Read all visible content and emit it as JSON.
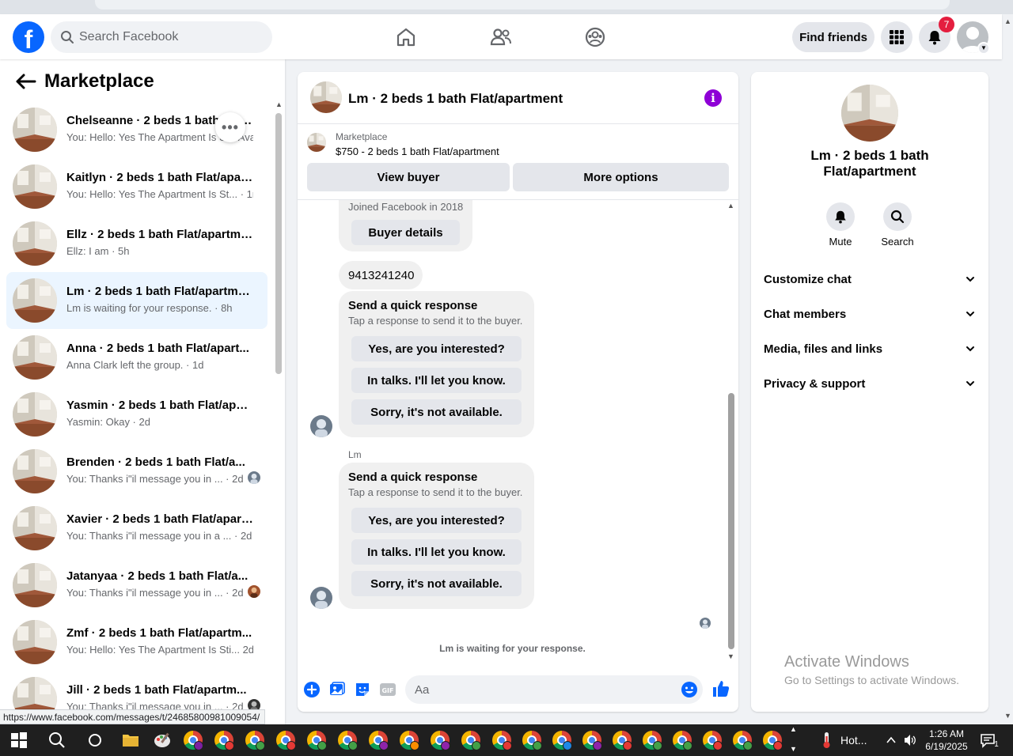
{
  "topnav": {
    "logo_letter": "f",
    "search_placeholder": "Search Facebook",
    "find_friends_label": "Find friends",
    "notification_count": "7"
  },
  "sidebar": {
    "title": "Marketplace",
    "more_label": "•••",
    "chats": [
      {
        "name": "Chelseanne · 2 beds 1 bath Flat/apartment",
        "preview": "You: Hello: Yes The Apartment Is Still Available · 1m"
      },
      {
        "name": "Kaitlyn · 2 beds 1 bath Flat/apart...",
        "preview": "You: Hello: Yes The Apartment Is St... · 1m"
      },
      {
        "name": "Ellz · 2 beds 1 bath Flat/apartment",
        "preview": "Ellz: I am · 5h"
      },
      {
        "name": "Lm · 2 beds 1 bath Flat/apartment",
        "preview": "Lm is waiting for your response. · 8h"
      },
      {
        "name": "Anna · 2 beds 1 bath Flat/apart...",
        "preview": "Anna Clark left the group. · 1d"
      },
      {
        "name": "Yasmin · 2 beds 1 bath Flat/apart...",
        "preview": "Yasmin: Okay · 2d"
      },
      {
        "name": "Brenden · 2 beds 1 bath Flat/a...",
        "preview": "You: Thanks i\"il message you in ... · 2d"
      },
      {
        "name": "Xavier · 2 beds 1 bath Flat/apart...",
        "preview": "You: Thanks i\"il message you in a ...   · 2d"
      },
      {
        "name": "Jatanyaa · 2 beds 1 bath Flat/a...",
        "preview": "You: Thanks i\"il message you in ... · 2d"
      },
      {
        "name": "Zmf · 2 beds 1 bath Flat/apartm...",
        "preview": "You: Hello: Yes The Apartment Is Sti... 2d"
      },
      {
        "name": "Jill · 2 beds 1 bath Flat/apartm...",
        "preview": "You: Thanks i\"il message you in ... · 2d"
      }
    ]
  },
  "status_url": "https://www.facebook.com/messages/t/24685800981009054/",
  "chat": {
    "title": "Lm · 2 beds 1 bath Flat/apartment",
    "listing_label": "Marketplace",
    "listing_desc": "$750 - 2 beds 1 bath Flat/apartment",
    "view_buyer_label": "View buyer",
    "more_options_label": "More options",
    "joined_text": "Joined Facebook in 2018",
    "buyer_details_label": "Buyer details",
    "phone_message": "9413241240",
    "sender_name": "Lm",
    "quick_response": {
      "title": "Send a quick response",
      "subtitle": "Tap a response to send it to the buyer.",
      "options": [
        "Yes, are you interested?",
        "In talks. I'll let you know.",
        "Sorry, it's not available."
      ]
    },
    "waiting_text": "Lm is waiting for your response.",
    "composer_placeholder": "Aa"
  },
  "info": {
    "name": "Lm · 2 beds 1 bath Flat/apartment",
    "mute_label": "Mute",
    "search_label": "Search",
    "sections": [
      "Customize chat",
      "Chat members",
      "Media, files and links",
      "Privacy & support"
    ]
  },
  "watermark": {
    "line1": "Activate Windows",
    "line2": "Go to Settings to activate Windows."
  },
  "taskbar": {
    "weather": "Hot...",
    "time": "1:26 AM",
    "date": "6/19/2025",
    "notification_count": "1"
  },
  "colors": {
    "brand": "#0866ff",
    "active_chat_bg": "#ebf5ff",
    "info_icon": "#8e00d6",
    "badge": "#e41e3f"
  }
}
